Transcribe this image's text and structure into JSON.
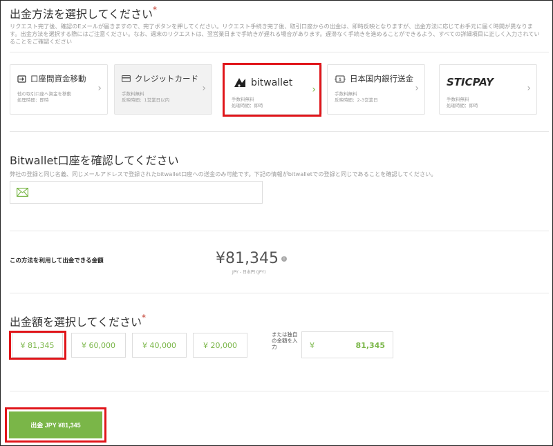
{
  "withdraw_method": {
    "title": "出金方法を選択してください",
    "required_mark": "*",
    "description": "リクエスト完了後、確認のEメールが届きますので、完了ボタンを押してください。リクエスト手続き完了後、取引口座からの出金は、即時反映となりますが、出金方法に応じてお手元に届く時間が異なります。出金方法を選択する際にはご注意ください。なお、週末のリクエストは、翌営業日まで手続きが遅れる場合があります。遅滞なく手続きを進めることができるよう、すべての詳細項目に正しく入力されていることをご確認ください",
    "cards": [
      {
        "title": "口座間資金移動",
        "line1": "他の取引口座へ資金を移動",
        "line2": "処理時間：即時",
        "icon": "transfer-icon"
      },
      {
        "title": "クレジットカード",
        "line1": "手数料無料",
        "line2": "反映時間：1営業日以内",
        "icon": "credit-card-icon"
      },
      {
        "title": "bitwallet",
        "line1": "手数料無料",
        "line2": "処理時間：即時",
        "icon": "bitwallet-logo"
      },
      {
        "title": "日本国内銀行送金",
        "line1": "手数料無料",
        "line2": "反映時間：2-3営業日",
        "icon": "bank-transfer-icon"
      },
      {
        "title": "STICPAY",
        "line1": "手数料無料",
        "line2": "処理時間：即時",
        "icon": "sticpay-logo"
      }
    ]
  },
  "bitwallet_confirm": {
    "title": "Bitwallet口座を確認してください",
    "description": "弊社の登録と同じ名義、同じメールアドレスで登録されたbitwallet口座への送金のみ可能です。下記の情報がbitwalletでの登録と同じであることを確認してください。",
    "email_value": ""
  },
  "available": {
    "label": "この方法を利用して出金できる金額",
    "amount": "¥81,345",
    "currency_note": "JPY - 日本円 (JPY)"
  },
  "select_amount": {
    "title": "出金額を選択してください",
    "required_mark": "*",
    "options": [
      {
        "yen": "¥",
        "value": "81,345"
      },
      {
        "yen": "¥",
        "value": "60,000"
      },
      {
        "yen": "¥",
        "value": "40,000"
      },
      {
        "yen": "¥",
        "value": "20,000"
      }
    ],
    "other_label": "または独自の金額を入力",
    "other_yen": "¥",
    "other_value": "81,345"
  },
  "submit": {
    "label": "出金 JPY ¥81,345"
  },
  "colors": {
    "accent_green": "#7ab648",
    "highlight_red": "#e0151a",
    "required_red": "#c0392b"
  }
}
